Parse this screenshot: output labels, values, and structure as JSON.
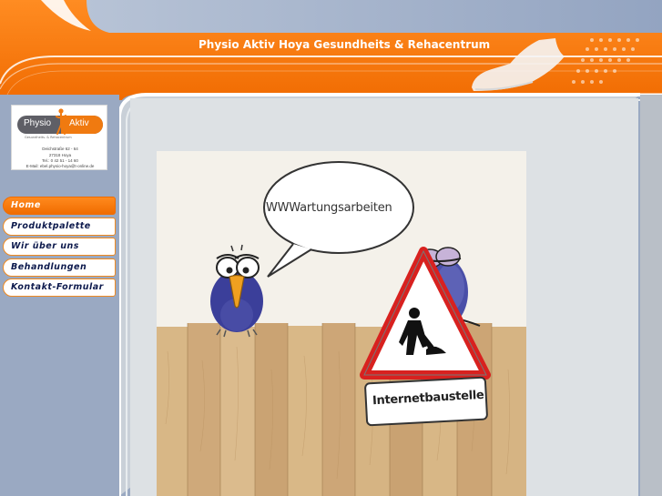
{
  "header": {
    "title": "Physio Aktiv Hoya Gesundheits & Rehacentrum"
  },
  "logo": {
    "word_left": "Physio",
    "word_right": "Aktiv",
    "subline": "Gesundheits- & Rehacentrum",
    "address_line1": "Deichstraße 62 - 64",
    "address_line2": "27318 Hoya",
    "address_line3": "Tel.: 0 42 51 - 14 60",
    "address_line4": "E-Mail: ebel.physio-hoya@t-online.de"
  },
  "nav": {
    "items": [
      {
        "label": "Home",
        "active": true
      },
      {
        "label": "Produktpalette",
        "active": false
      },
      {
        "label": "Wir über uns",
        "active": false
      },
      {
        "label": "Behandlungen",
        "active": false
      },
      {
        "label": "Kontakt-Formular",
        "active": false
      }
    ]
  },
  "cartoon": {
    "bubble_text": "WWWartungsarbeiten",
    "sign_text": "Internetbaustelle"
  },
  "colors": {
    "orange": "#f47a0c",
    "blue_grey": "#9aa9c2",
    "content_bg": "#dde1e4",
    "nav_text": "#0d1a4d"
  }
}
